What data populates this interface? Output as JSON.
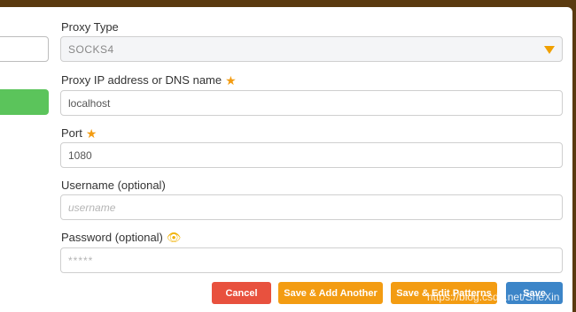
{
  "form": {
    "proxy_type": {
      "label": "Proxy Type",
      "value": "SOCKS4"
    },
    "proxy_host": {
      "label": "Proxy IP address or DNS name",
      "value": "localhost"
    },
    "port": {
      "label": "Port",
      "value": "1080"
    },
    "username": {
      "label": "Username (optional)",
      "placeholder": "username"
    },
    "password": {
      "label": "Password (optional)",
      "placeholder": "*****"
    }
  },
  "buttons": {
    "cancel": "Cancel",
    "save_add": "Save & Add Another",
    "save_edit": "Save & Edit Patterns",
    "save": "Save"
  },
  "watermark": "https://blog.csdn.net/SheXin",
  "colors": {
    "accent": "#f39c12",
    "cancel": "#e8513e",
    "save": "#3c85c8",
    "left_green": "#5bc45b",
    "background": "#5a3a10"
  },
  "icons": {
    "required": "star-icon",
    "reveal": "eye-icon",
    "dropdown": "caret-down-icon"
  }
}
